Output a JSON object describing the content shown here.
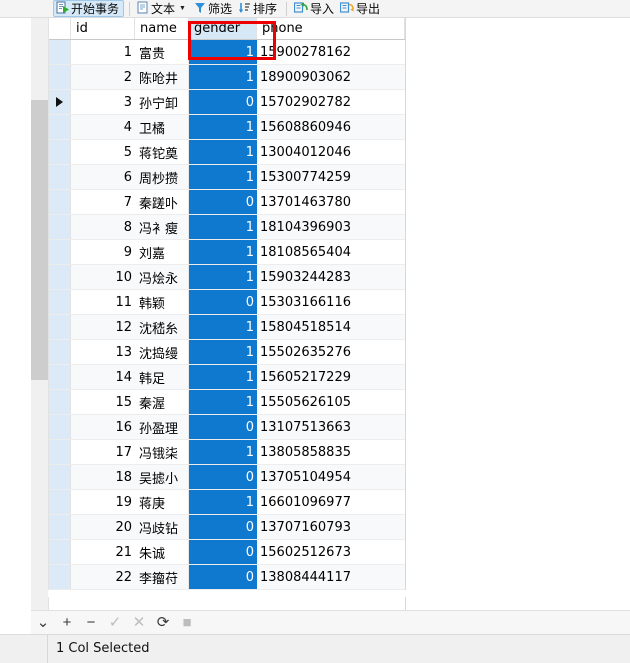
{
  "toolbar": {
    "buttons": [
      {
        "label": "开始事务",
        "icon": "transaction-start-icon",
        "active": true,
        "caret": false
      },
      {
        "label": "文本",
        "icon": "text-icon",
        "active": false,
        "caret": true
      },
      {
        "label": "筛选",
        "icon": "filter-icon",
        "active": false,
        "caret": false
      },
      {
        "label": "排序",
        "icon": "sort-icon",
        "active": false,
        "caret": false
      },
      {
        "label": "导入",
        "icon": "import-icon",
        "active": false,
        "caret": false
      },
      {
        "label": "导出",
        "icon": "export-icon",
        "active": false,
        "caret": false
      }
    ]
  },
  "grid": {
    "columns": [
      "id",
      "name",
      "gender",
      "phone"
    ],
    "selected_column": "gender",
    "current_row_index": 2,
    "rows": [
      {
        "id": "1",
        "name": "富贵",
        "gender": "1",
        "phone": "15900278162"
      },
      {
        "id": "2",
        "name": "陈呛井",
        "gender": "1",
        "phone": "18900903062"
      },
      {
        "id": "3",
        "name": "孙宁卸",
        "gender": "0",
        "phone": "15702902782"
      },
      {
        "id": "4",
        "name": "卫橘",
        "gender": "1",
        "phone": "15608860946"
      },
      {
        "id": "5",
        "name": "蒋铊奠",
        "gender": "1",
        "phone": "13004012046"
      },
      {
        "id": "6",
        "name": "周杪攒",
        "gender": "1",
        "phone": "15300774259"
      },
      {
        "id": "7",
        "name": "秦蹉卟",
        "gender": "0",
        "phone": "13701463780"
      },
      {
        "id": "8",
        "name": "冯衤瘦",
        "gender": "1",
        "phone": "18104396903"
      },
      {
        "id": "9",
        "name": "刘嘉",
        "gender": "1",
        "phone": "18108565404"
      },
      {
        "id": "10",
        "name": "冯烩永",
        "gender": "1",
        "phone": "15903244283"
      },
      {
        "id": "11",
        "name": "韩颖",
        "gender": "0",
        "phone": "15303166116"
      },
      {
        "id": "12",
        "name": "沈嵇糸",
        "gender": "1",
        "phone": "15804518514"
      },
      {
        "id": "13",
        "name": "沈捣缦",
        "gender": "1",
        "phone": "15502635276"
      },
      {
        "id": "14",
        "name": "韩足",
        "gender": "1",
        "phone": "15605217229"
      },
      {
        "id": "15",
        "name": "秦渥",
        "gender": "1",
        "phone": "15505626105"
      },
      {
        "id": "16",
        "name": "孙盈理",
        "gender": "0",
        "phone": "13107513663"
      },
      {
        "id": "17",
        "name": "冯锇柒",
        "gender": "1",
        "phone": "13805858835"
      },
      {
        "id": "18",
        "name": "吴摅小",
        "gender": "0",
        "phone": "13705104954"
      },
      {
        "id": "19",
        "name": "蒋庚",
        "gender": "1",
        "phone": "16601096977"
      },
      {
        "id": "20",
        "name": "冯歧钻",
        "gender": "0",
        "phone": "13707160793"
      },
      {
        "id": "21",
        "name": "朱诚",
        "gender": "0",
        "phone": "15602512673"
      },
      {
        "id": "22",
        "name": "李籀苻",
        "gender": "0",
        "phone": "13808444117"
      }
    ]
  },
  "bottom_nav": {
    "buttons": [
      {
        "name": "chevron-down",
        "glyph": "⌄",
        "enabled": true
      },
      {
        "name": "add-record",
        "glyph": "+",
        "enabled": true
      },
      {
        "name": "delete-record",
        "glyph": "−",
        "enabled": true
      },
      {
        "name": "confirm-edit",
        "glyph": "✓",
        "enabled": false
      },
      {
        "name": "cancel-edit",
        "glyph": "✕",
        "enabled": false
      },
      {
        "name": "refresh",
        "glyph": "⟳",
        "enabled": true
      },
      {
        "name": "stop",
        "glyph": "■",
        "enabled": false
      }
    ]
  },
  "status": {
    "text": "1 Col Selected"
  },
  "colors": {
    "selection_blue": "#0f79d0",
    "header_selected": "#d6e7f5",
    "gutter_blue": "#dce9f7",
    "annotation_red": "#ee0000",
    "toolbar_bg": "#f4f4f4"
  }
}
